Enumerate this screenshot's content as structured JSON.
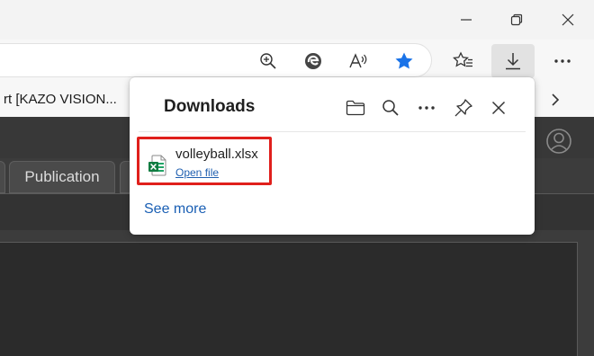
{
  "window": {
    "minimize_icon": "minimize-icon",
    "restore_icon": "restore-icon",
    "close_icon": "close-icon"
  },
  "toolbar": {
    "icons": [
      "zoom-icon",
      "edge-icon",
      "read-aloud-icon",
      "favorite-star-icon",
      "favorites-list-icon",
      "download-icon",
      "more-icon"
    ],
    "star_color": "#1a73e8"
  },
  "favorites_bar": {
    "item_text": "rt [KAZO VISION..."
  },
  "page": {
    "tabs": [
      {
        "label": ""
      },
      {
        "label": "Publication"
      },
      {
        "label": ""
      }
    ]
  },
  "downloads": {
    "title": "Downloads",
    "item": {
      "filename": "volleyball.xlsx",
      "action": "Open file"
    },
    "see_more": "See more",
    "highlight_color": "#e0201c"
  }
}
